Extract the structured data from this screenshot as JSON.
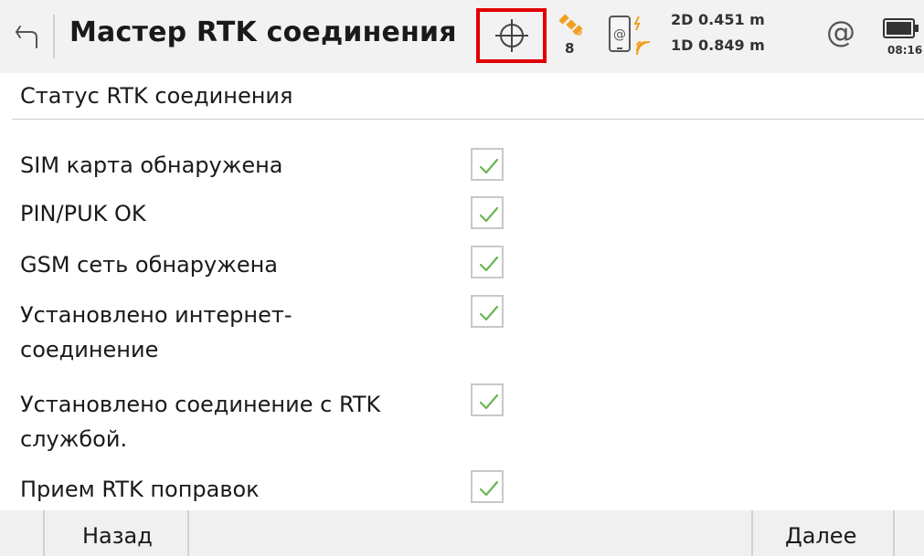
{
  "header": {
    "title": "Мастер RTK соединения",
    "satellite_count": "8",
    "accuracy_2d": "2D 0.451 m",
    "accuracy_1d": "1D 0.849 m",
    "at_symbol": "@",
    "time": "08:16",
    "icons": [
      "back-arrow-icon",
      "crosshair-icon",
      "satellite-icon",
      "rover-device-icon",
      "at-icon",
      "battery-icon"
    ],
    "highlight_color": "#e00000"
  },
  "section": {
    "title": "Статус RTK соединения"
  },
  "status_items": [
    {
      "label": "SIM карта обнаружена",
      "checked": true
    },
    {
      "label": "PIN/PUK OK",
      "checked": true
    },
    {
      "label": "GSM сеть обнаружена",
      "checked": true
    },
    {
      "label": "Установлено интернет-соединение",
      "checked": true
    },
    {
      "label": "Установлено соединение с  RTK службой.",
      "checked": true
    },
    {
      "label": "Прием RTK поправок",
      "checked": true
    }
  ],
  "footer": {
    "back_label": "Назад",
    "next_label": "Далее"
  },
  "colors": {
    "check_green": "#6cb552",
    "header_bg": "#f2f2f2",
    "footer_bg": "#f0f0f0"
  }
}
